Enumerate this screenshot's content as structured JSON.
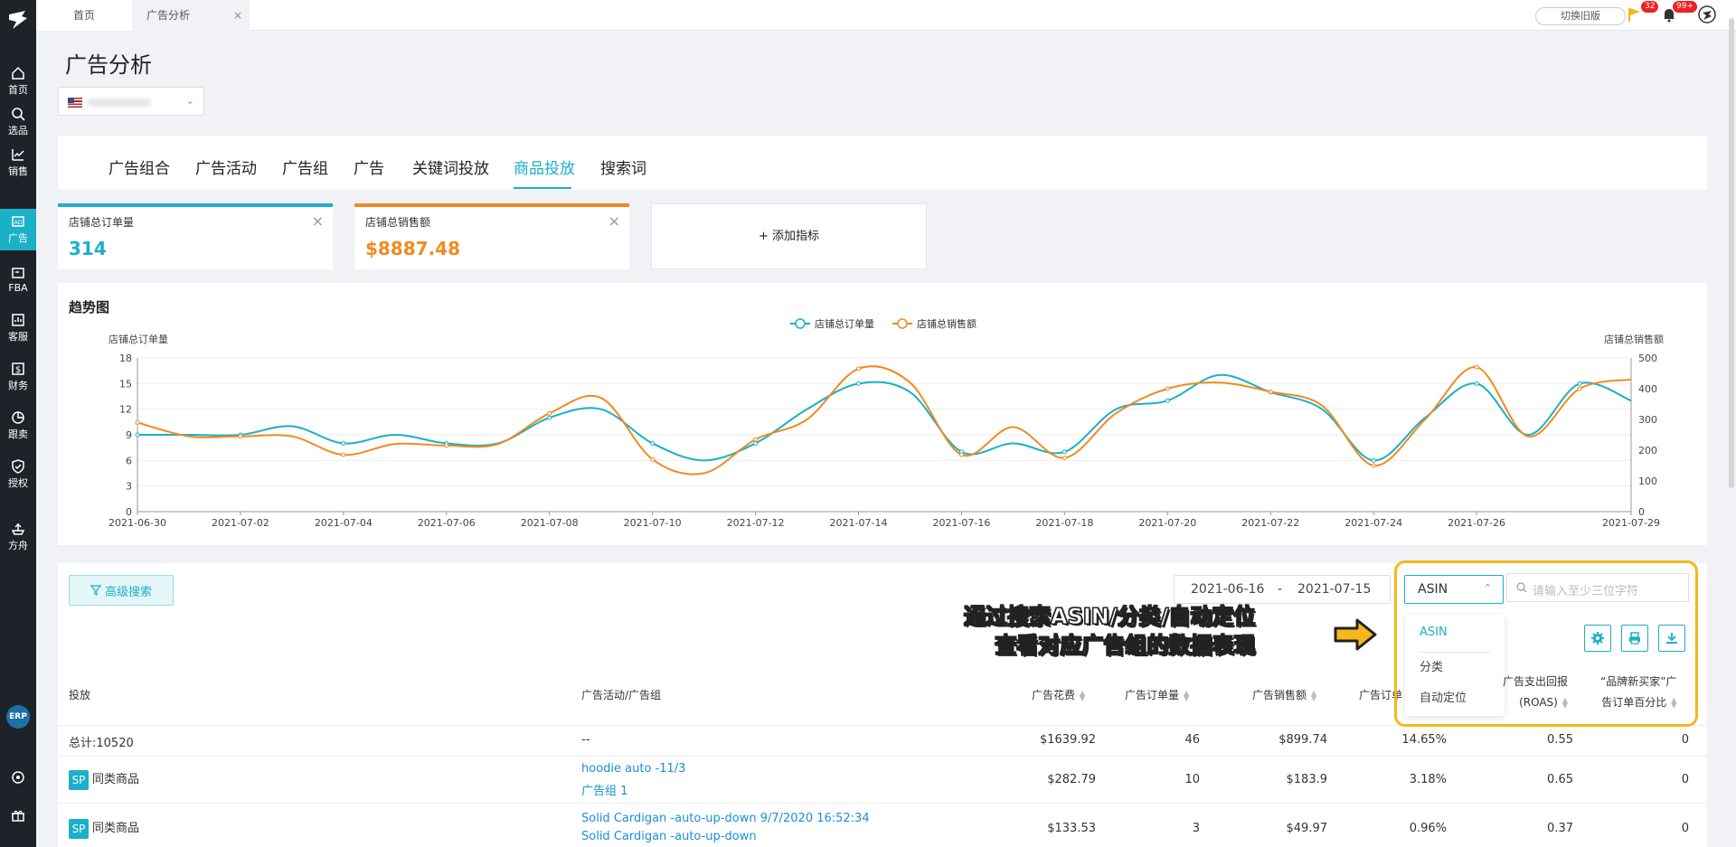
{
  "sidebar": {
    "items": [
      {
        "label": "首页",
        "icon": "home-icon"
      },
      {
        "label": "选品",
        "icon": "search-icon"
      },
      {
        "label": "销售",
        "icon": "chart-line-icon"
      },
      {
        "label": "广告",
        "icon": "ad-icon"
      },
      {
        "label": "FBA",
        "icon": "box-icon"
      },
      {
        "label": "客服",
        "icon": "service-icon"
      },
      {
        "label": "财务",
        "icon": "finance-icon"
      },
      {
        "label": "跟卖",
        "icon": "pie-icon"
      },
      {
        "label": "授权",
        "icon": "shield-icon"
      },
      {
        "label": "方舟",
        "icon": "ark-icon"
      }
    ],
    "erp_label": "ERP"
  },
  "topbar": {
    "tabs": [
      {
        "label": "首页"
      },
      {
        "label": "广告分析",
        "close": "×"
      }
    ],
    "switch_label": "切换旧版",
    "flag_badge": "32",
    "bell_badge": "99+"
  },
  "header": {
    "title": "广告分析"
  },
  "nav": {
    "tabs": [
      "广告组合",
      "广告活动",
      "广告组",
      "广告",
      "关键词投放",
      "商品投放",
      "搜索词"
    ],
    "active_index": 5
  },
  "metrics": [
    {
      "label": "店铺总订单量",
      "value": "314",
      "color": "#1ab0c7"
    },
    {
      "label": "店铺总销售额",
      "value": "$8887.48",
      "color": "#f28a1e"
    }
  ],
  "add_metric_label": "+ 添加指标",
  "chart_title": "趋势图",
  "chart_data": {
    "type": "line",
    "x": [
      "2021-06-30",
      "2021-07-01",
      "2021-07-02",
      "2021-07-03",
      "2021-07-04",
      "2021-07-05",
      "2021-07-06",
      "2021-07-07",
      "2021-07-08",
      "2021-07-09",
      "2021-07-10",
      "2021-07-11",
      "2021-07-12",
      "2021-07-13",
      "2021-07-14",
      "2021-07-15",
      "2021-07-16",
      "2021-07-17",
      "2021-07-18",
      "2021-07-19",
      "2021-07-20",
      "2021-07-21",
      "2021-07-22",
      "2021-07-23",
      "2021-07-24",
      "2021-07-25",
      "2021-07-26",
      "2021-07-27",
      "2021-07-28",
      "2021-07-29"
    ],
    "x_tick_labels": [
      "2021-06-30",
      "2021-07-02",
      "2021-07-04",
      "2021-07-06",
      "2021-07-08",
      "2021-07-10",
      "2021-07-12",
      "2021-07-14",
      "2021-07-16",
      "2021-07-18",
      "2021-07-20",
      "2021-07-22",
      "2021-07-24",
      "2021-07-26",
      "2021-07-29"
    ],
    "series": [
      {
        "name": "店铺总订单量",
        "axis": "left",
        "color": "#1ab0c7",
        "values": [
          9,
          9,
          9,
          10,
          8,
          9,
          8,
          8,
          11,
          12,
          8,
          6,
          8,
          12,
          15,
          14,
          7,
          8,
          7,
          12,
          13,
          16,
          14,
          12,
          6,
          11,
          15,
          9,
          15,
          13
        ]
      },
      {
        "name": "店铺总销售额",
        "axis": "right",
        "color": "#f28a1e",
        "values": [
          290,
          245,
          245,
          245,
          185,
          220,
          215,
          220,
          320,
          370,
          170,
          125,
          235,
          300,
          465,
          420,
          185,
          275,
          175,
          320,
          400,
          420,
          390,
          345,
          150,
          300,
          470,
          245,
          400,
          430
        ]
      }
    ],
    "ylabel_left": "店铺总订单量",
    "ylabel_right": "店铺总销售额",
    "ylim_left": [
      0,
      18
    ],
    "yticks_left": [
      "0",
      "3",
      "6",
      "9",
      "12",
      "15",
      "18"
    ],
    "ylim_right": [
      0,
      500
    ],
    "yticks_right": [
      "0",
      "100",
      "200",
      "300",
      "400",
      "500"
    ],
    "legend": "top-center",
    "grid": true
  },
  "toolbar": {
    "advanced_search": "高级搜索",
    "date_start": "2021-06-16",
    "date_sep": "-",
    "date_end": "2021-07-15",
    "select_value": "ASIN",
    "search_placeholder": "请输入至少三位字符",
    "dropdown_options": [
      "ASIN",
      "分类",
      "自动定位"
    ]
  },
  "annotation": {
    "line1": "通过搜索ASIN/分类/自动定位",
    "line2": "查看对应广告组的数据表现"
  },
  "table": {
    "headers": {
      "target": "投放",
      "campaign": "广告活动/广告组",
      "spend": "广告花费",
      "orders": "广告订单量",
      "sales": "广告销售额",
      "order_rate": "广告订单",
      "roas_line1": "广告支出回报",
      "roas_line2": "(ROAS)",
      "brand_line1": "“品牌新买家”广",
      "brand_line2": "告订单百分比"
    },
    "total": {
      "label": "总计:10520",
      "campaign": "--",
      "spend": "$1639.92",
      "orders": "46",
      "sales": "$899.74",
      "rate": "14.65%",
      "roas": "0.55",
      "brand": "0"
    },
    "rows": [
      {
        "badge": "SP",
        "target": "同类商品",
        "campaign": "hoodie auto -11/3",
        "group": "广告组 1",
        "spend": "$282.79",
        "orders": "10",
        "sales": "$183.9",
        "rate": "3.18%",
        "roas": "0.65",
        "brand": "0"
      },
      {
        "badge": "SP",
        "target": "同类商品",
        "campaign": "Solid Cardigan -auto-up-down 9/7/2020 16:52:34",
        "group": "Solid Cardigan -auto-up-down",
        "spend": "$133.53",
        "orders": "3",
        "sales": "$49.97",
        "rate": "0.96%",
        "roas": "0.37",
        "brand": "0"
      }
    ]
  }
}
